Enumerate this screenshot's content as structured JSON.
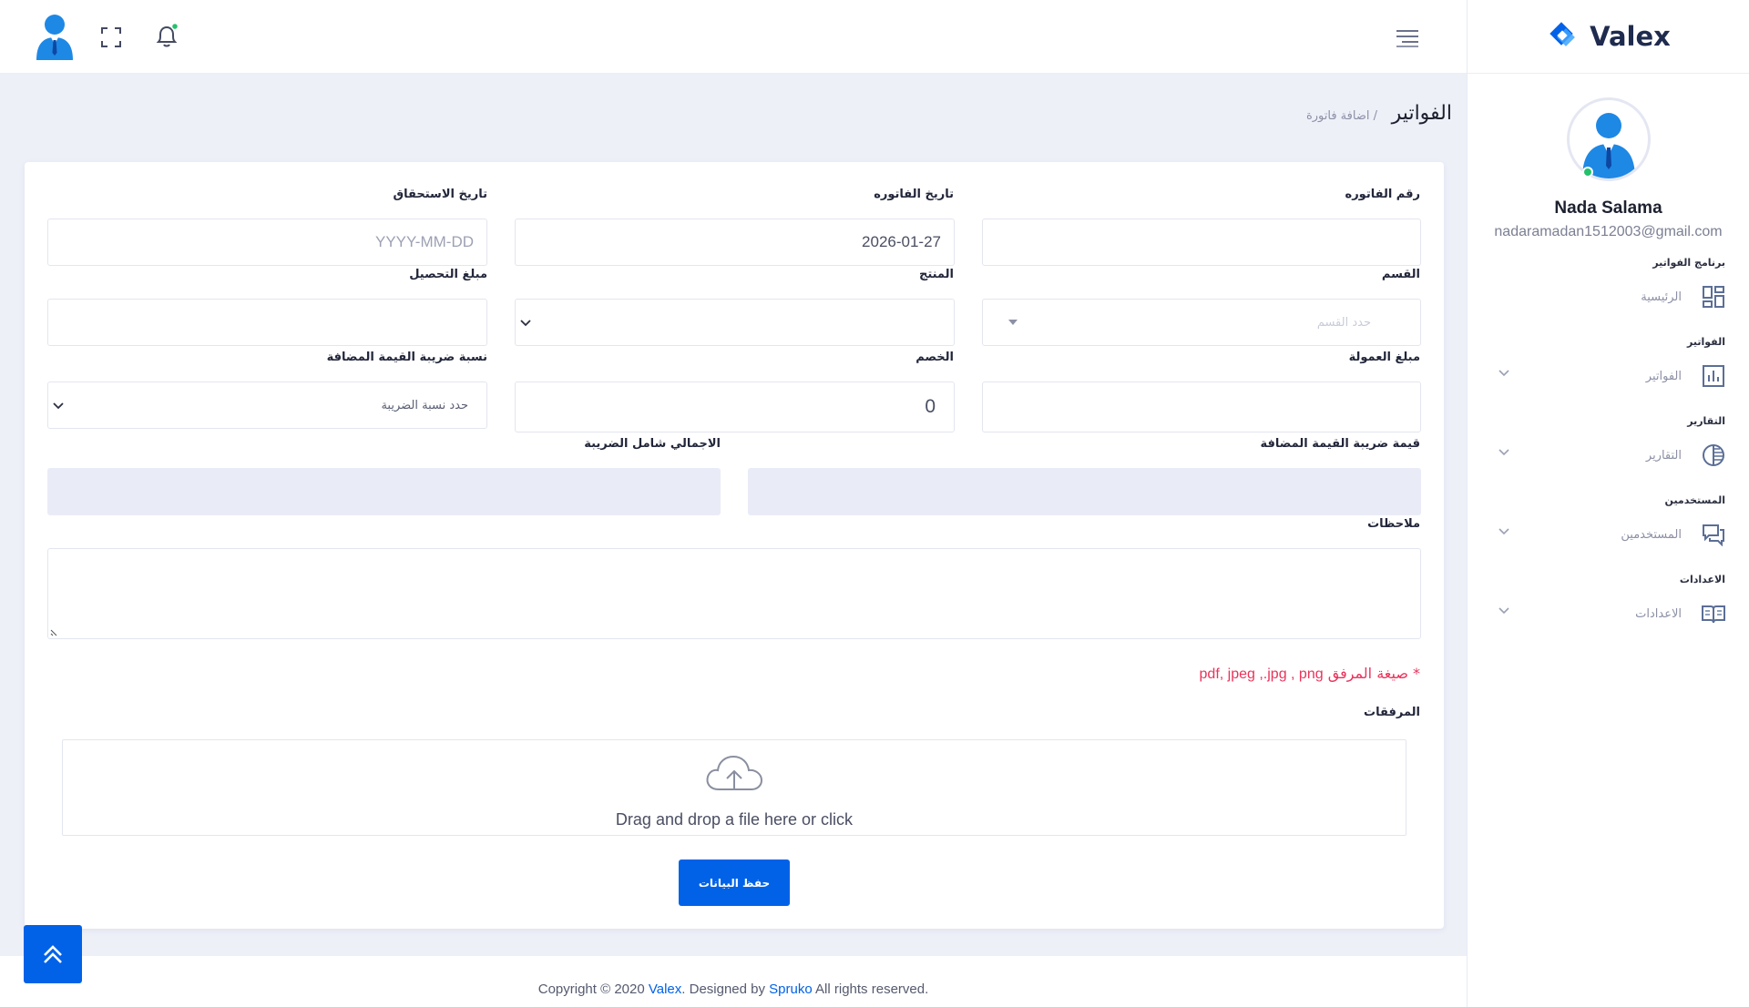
{
  "brand": {
    "name": "Valex",
    "accent": "#0162e8"
  },
  "header": {
    "avatar_icon": "user-avatar-icon",
    "fullscreen_icon": "fullscreen-icon",
    "bell_icon": "bell-icon",
    "menu_icon": "hamburger-icon"
  },
  "sidebar": {
    "user_name": "Nada Salama",
    "user_email": "nadaramadan1512003@gmail.com",
    "sections": [
      {
        "category": "برنامج الفواتير",
        "item": "الرئيسية",
        "icon": "dashboard-icon",
        "has_chevron": false
      },
      {
        "category": "الفواتير",
        "item": "الفواتير",
        "icon": "bar-chart-icon",
        "has_chevron": true
      },
      {
        "category": "التقارير",
        "item": "التقارير",
        "icon": "pie-chart-icon",
        "has_chevron": true
      },
      {
        "category": "المستخدمين",
        "item": "المستخدمين",
        "icon": "chat-icon",
        "has_chevron": true
      },
      {
        "category": "الاعدادات",
        "item": "الاعدادات",
        "icon": "book-icon",
        "has_chevron": true
      }
    ]
  },
  "page": {
    "title": "الفواتير",
    "breadcrumb": "/ اضافة فاتورة"
  },
  "form": {
    "invoice_number_label": "رقم الفاتوره",
    "invoice_number_value": "",
    "invoice_date_label": "تاريخ الفاتوره",
    "invoice_date_value": "2026-01-27",
    "due_date_label": "تاريخ الاستحقاق",
    "due_date_placeholder": "YYYY-MM-DD",
    "section_label": "القسم",
    "section_placeholder": "حدد القسم",
    "product_label": "المنتج",
    "collection_label": "مبلغ التحصيل",
    "commission_label": "مبلغ العمولة",
    "discount_label": "الخصم",
    "discount_value": "0",
    "vat_rate_label": "نسبة ضريبة القيمة المضافة",
    "vat_rate_placeholder": "حدد نسبة الضريبة",
    "vat_value_label": "قيمة ضريبة القيمة المضافة",
    "total_label": "الاجمالي شامل الضريبة",
    "notes_label": "ملاحظات",
    "attachment_hint_ar": "* صيغة المرفق",
    "attachment_hint_formats": "pdf, jpeg ,.jpg , png",
    "attachments_label": "المرفقات",
    "dropzone_text": "Drag and drop a file here or click",
    "save_label": "حفظ البيانات"
  },
  "footer": {
    "prefix": "Copyright © 2020 ",
    "brand": "Valex",
    "middle": ". Designed by ",
    "designer": "Spruko",
    "suffix": " All rights reserved."
  }
}
